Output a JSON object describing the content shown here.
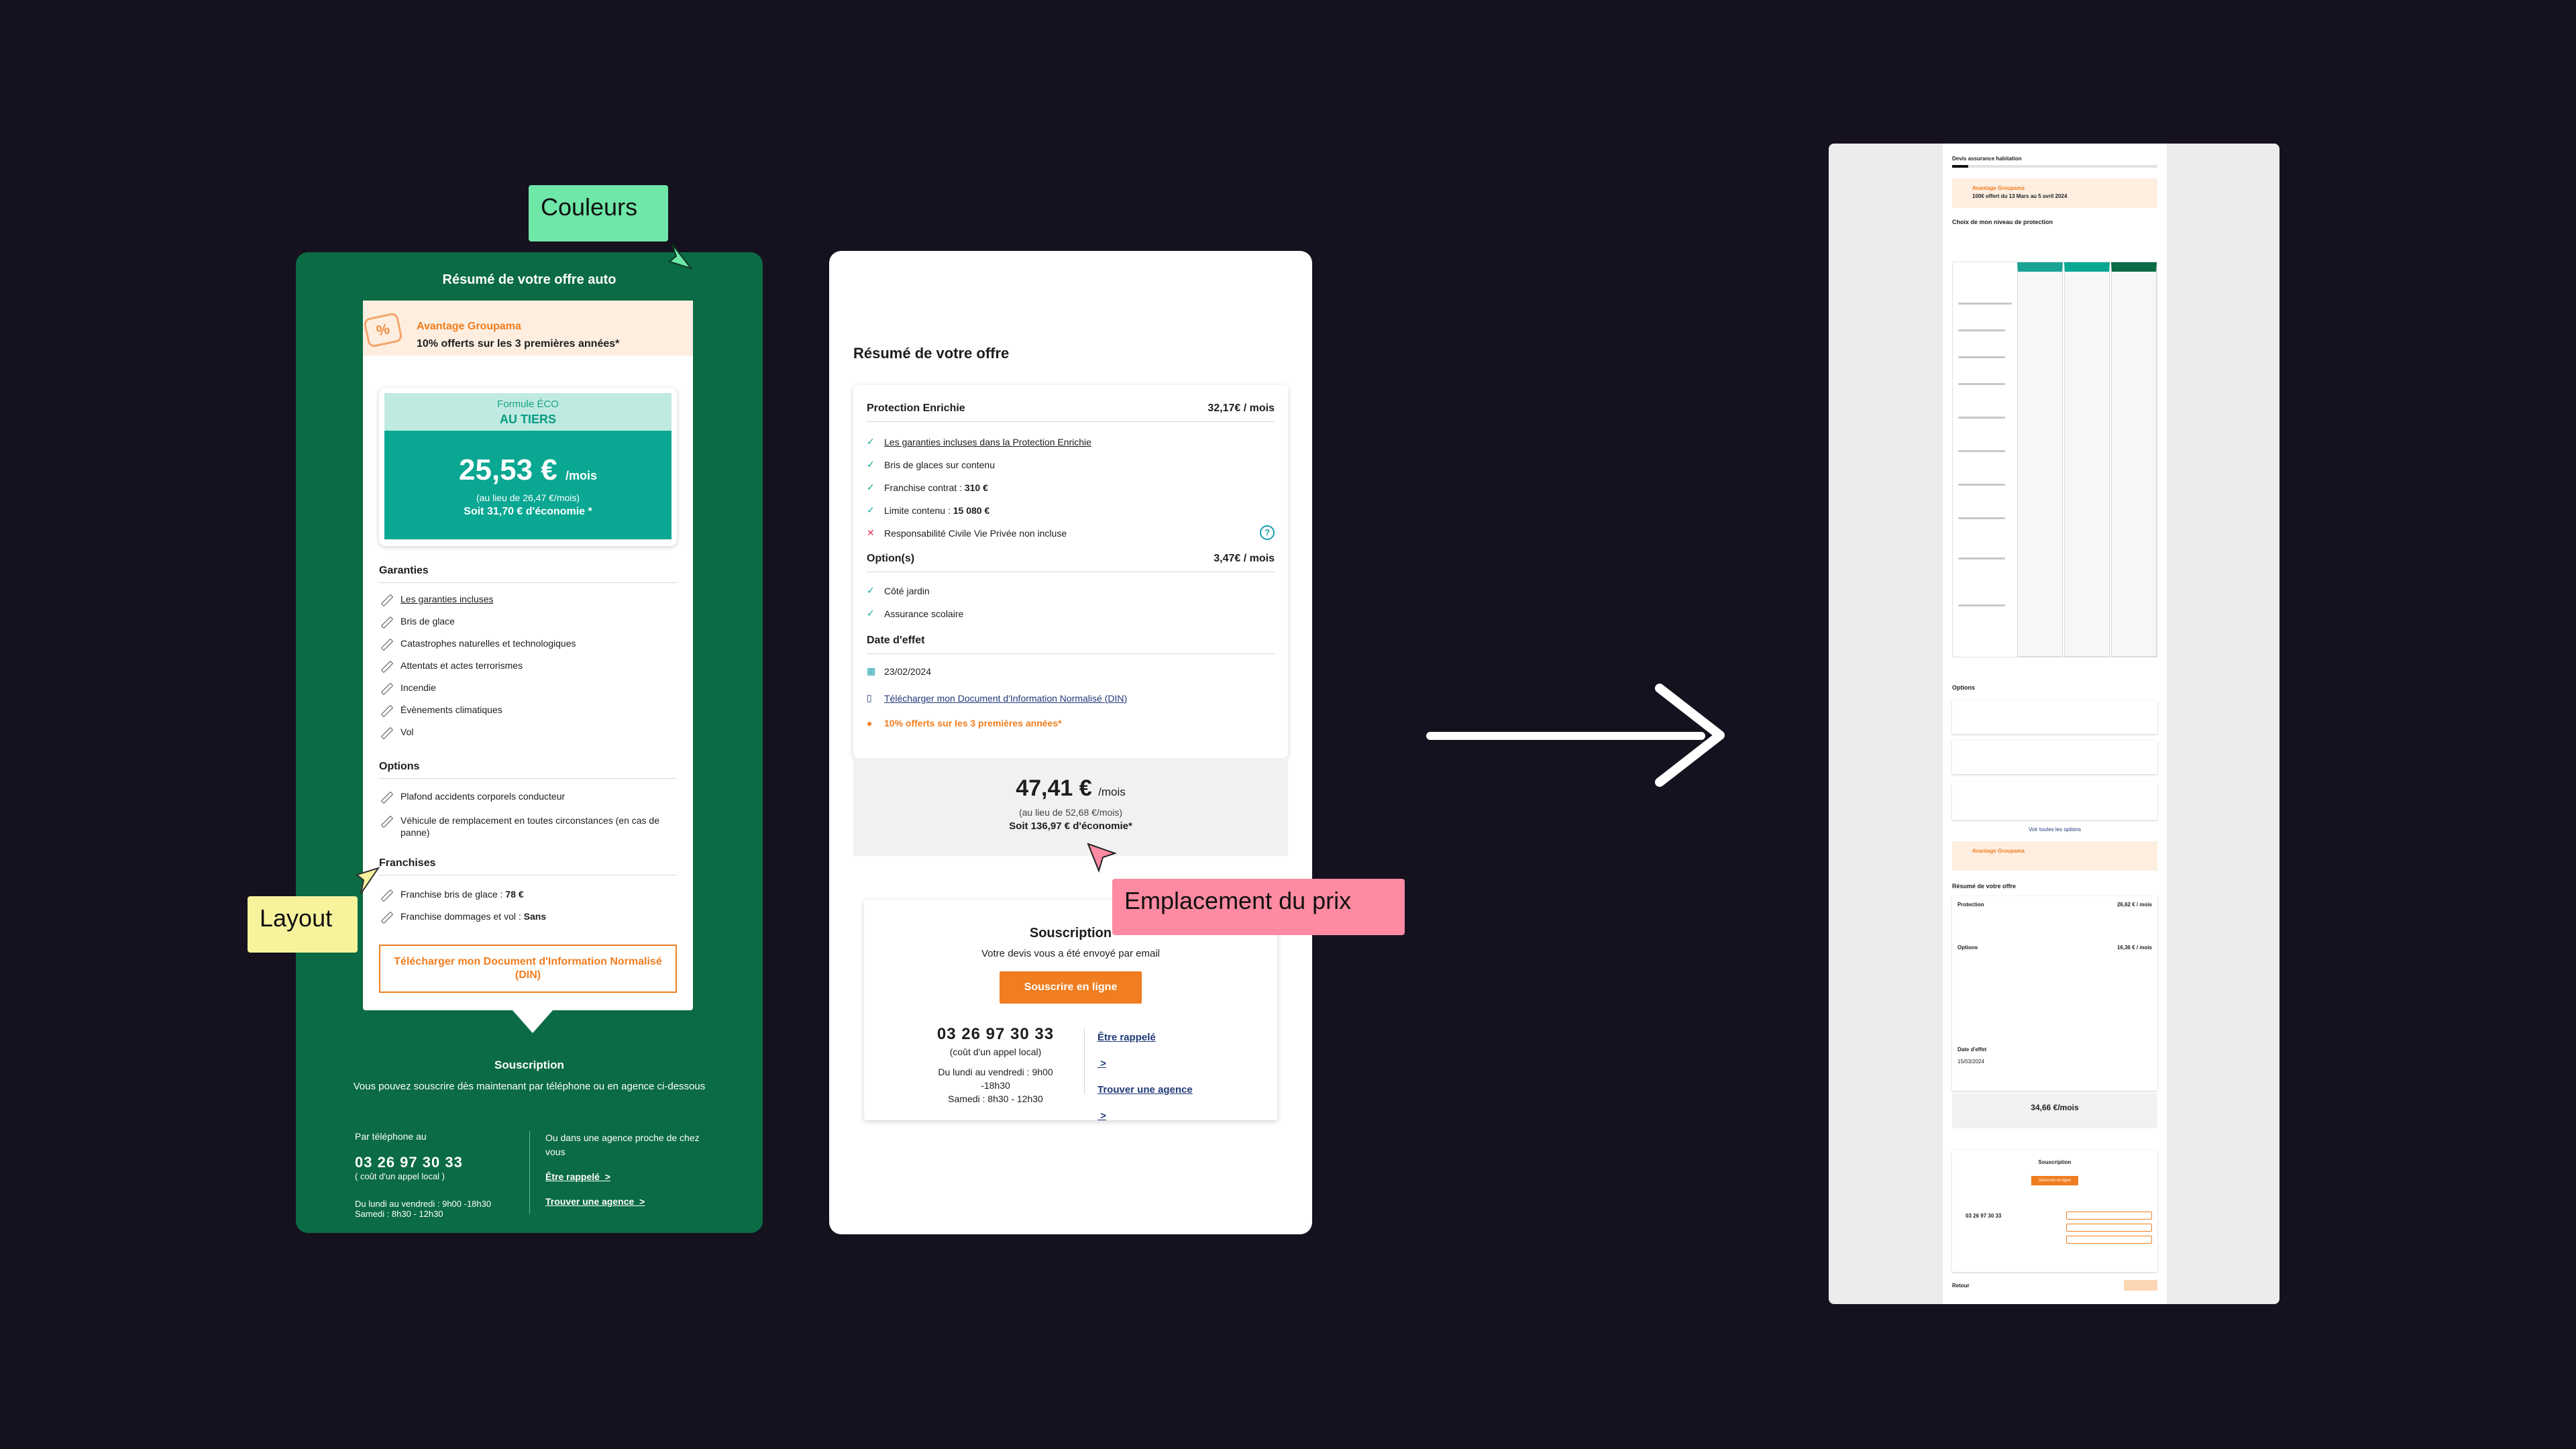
{
  "annotations": {
    "couleurs": "Couleurs",
    "layout": "Layout",
    "prix": "Emplacement du prix"
  },
  "auto": {
    "title": "Résumé de votre offre auto",
    "promo_icon": "%",
    "promo_title": "Avantage Groupama",
    "promo_text": "10% offerts sur les 3 premières années*",
    "formula_line1": "Formule ÉCO",
    "formula_line2": "AU TIERS",
    "price": "25,53 €",
    "price_unit": "/mois",
    "price_was": "(au lieu de 26,47 €/mois)",
    "price_save": "Soit 31,70 € d'économie *",
    "garanties_title": "Garanties",
    "garanties": [
      "Les garanties incluses",
      "Bris de glace",
      "Catastrophes naturelles et technologiques",
      "Attentats et actes terrorismes",
      "Incendie",
      "Évènements climatiques",
      "Vol"
    ],
    "options_title": "Options",
    "options": [
      "Plafond accidents corporels conducteur",
      "Véhicule de remplacement en toutes circonstances (en cas de panne)"
    ],
    "franchises_title": "Franchises",
    "franchise1_label": "Franchise bris de glace : ",
    "franchise1_value": "78 €",
    "franchise2_label": "Franchise dommages et vol : ",
    "franchise2_value": "Sans",
    "download": "Télécharger mon Document d'Information Normalisé (DIN)",
    "subs_title": "Souscription",
    "subs_desc": "Vous pouvez souscrire dès maintenant par téléphone ou en agence ci-dessous",
    "phone_label": "Par téléphone au",
    "phone": "03 26 97 30 33",
    "phone_cost": "( coût d'un appel local )",
    "hours1": "Du lundi au vendredi : 9h00 -18h30",
    "hours2": "Samedi : 8h30 - 12h30",
    "agency_text": "Ou dans une agence proche de chez vous",
    "callback": "Être rappelé",
    "find_agency": "Trouver une agence"
  },
  "offre": {
    "title": "Résumé de votre offre",
    "protection_label": "Protection Enrichie",
    "protection_price": "32,17€ / mois",
    "items": [
      "Les garanties incluses dans la Protection Enrichie",
      "Bris de glaces sur contenu"
    ],
    "franchise_label": "Franchise contrat : ",
    "franchise_value": "310 €",
    "limite_label": "Limite contenu : ",
    "limite_value": "15 080 €",
    "excluded": "Responsabilité Civile Vie Privée non incluse",
    "options_label": "Option(s)",
    "options_price": "3,47€ / mois",
    "options": [
      "Côté jardin",
      "Assurance scolaire"
    ],
    "date_label": "Date d'effet",
    "date_value": "23/02/2024",
    "din_link": "Télécharger mon Document d'Information Normalisé (DIN)",
    "promo": "10% offerts sur les 3 premières années*",
    "price": "47,41 €",
    "price_unit": "/mois",
    "price_was": "(au lieu de 52,68 €/mois)",
    "price_save": "Soit 136,97 € d'économie*",
    "subs_title": "Souscription",
    "subs_desc": "Votre devis vous a été envoyé par email",
    "subs_cta": "Souscrire en ligne",
    "phone": "03 26 97 30 33",
    "phone_cost": "(coût d'un appel local)",
    "hours1": "Du lundi au vendredi : 9h00 -18h30",
    "hours2": "Samedi : 8h30 - 12h30",
    "callback": "Être rappelé",
    "find_agency": "Trouver une agence"
  },
  "mini": {
    "header": "Devis assurance habitation",
    "promo_title": "Avantage Groupama",
    "promo_text": "100€ offert du 13 Mars au 5 avril 2024",
    "choice_title": "Choix de mon niveau de protection",
    "options_title": "Options",
    "see_all": "Voir toutes les options",
    "promo2_title": "Avantage Groupama",
    "summary_title": "Résumé de votre offre",
    "protection": "Protection",
    "protection_price": "26,62 € / mois",
    "options_label": "Options",
    "options_price": "16,36 € / mois",
    "date_label": "Date d'effet",
    "date_value": "15/03/2024",
    "price": "34,66 €/mois",
    "subs_title": "Souscription",
    "subs_cta": "Souscrire en ligne",
    "phone": "03 26 97 30 33",
    "back": "Retour"
  }
}
